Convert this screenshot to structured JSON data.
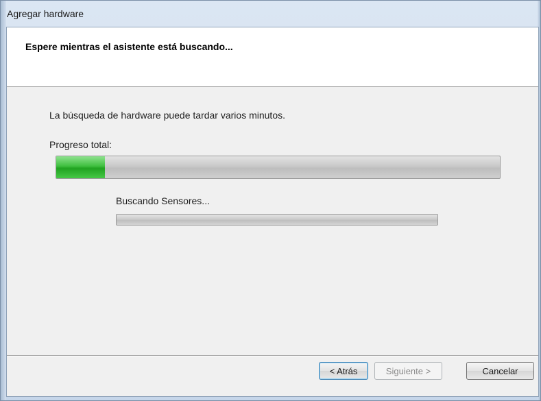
{
  "window": {
    "title": "Agregar hardware"
  },
  "header": {
    "title": "Espere mientras el asistente está buscando..."
  },
  "content": {
    "description": "La búsqueda de hardware puede tardar varios minutos.",
    "total_progress_label": "Progreso total:",
    "total_progress_value": 0.11,
    "sub_progress_label": "Buscando Sensores...",
    "sub_progress_value": 0
  },
  "buttons": {
    "back": "< Atrás",
    "next": "Siguiente >",
    "cancel": "Cancelar"
  },
  "colors": {
    "progress_fill": "#2db52d",
    "header_background": "#ffffff",
    "body_background": "#f0f0f0"
  }
}
